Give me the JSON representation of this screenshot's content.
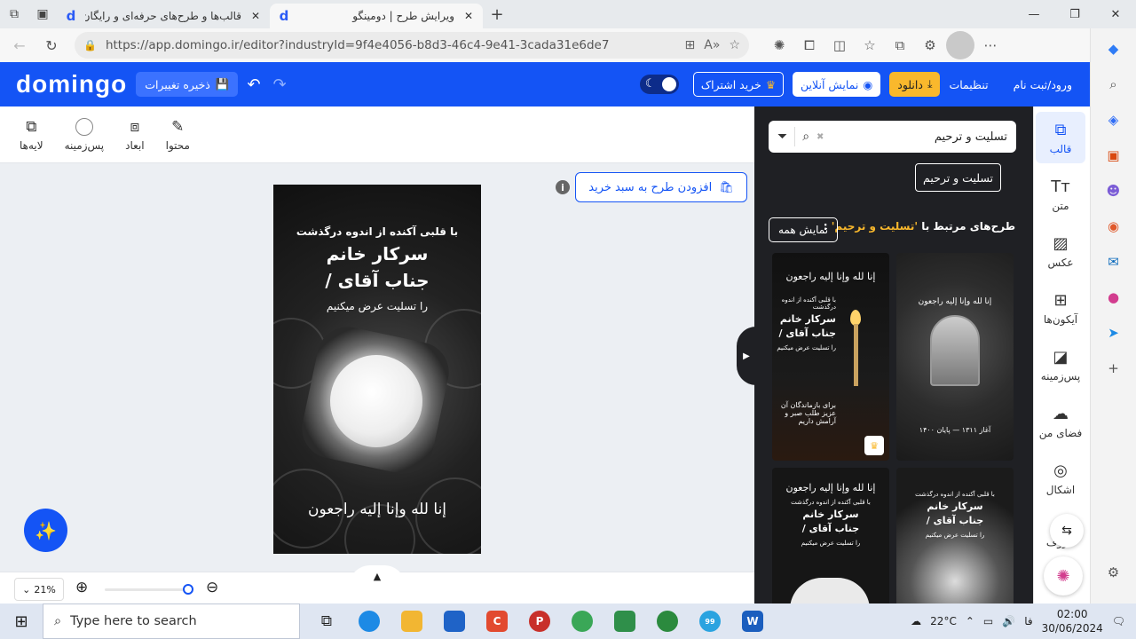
{
  "browser": {
    "tabs": [
      {
        "title": "قالب‌ها و طرح‌های حرفه‌ای و رایگان",
        "active": false
      },
      {
        "title": "ویرایش طرح | دومینگو",
        "active": true
      }
    ],
    "favicon_letter": "d",
    "new_tab": "+",
    "url": "https://app.domingo.ir/editor?industryId=9f4e4056-b8d3-46c4-9e41-3cada31e6de7"
  },
  "header": {
    "logo": "domingo",
    "save_label": "ذخیره تغییرات",
    "login_label": "ورود/ثبت نام",
    "settings_label": "تنظیمات",
    "download_label": "دانلود",
    "preview_label": "نمایش آنلاین",
    "subscribe_label": "خرید اشتراک"
  },
  "toolbar": {
    "content": "محتوا",
    "dimensions": "ابعاد",
    "background": "پس‌زمینه",
    "layers": "لایه‌ها"
  },
  "design": {
    "subtitle": "با قلبی آکنده از اندوه درگذشت",
    "line1": "سرکار خانم",
    "line2": "/ جناب آقای",
    "line3": "را تسلیت عرض میکنیم",
    "verse": "إنا لله وإنا إليه راجعون"
  },
  "editor": {
    "add_to_cart": "افزودن طرح به سبد خرید",
    "info": "i",
    "zoom": "21%"
  },
  "panel": {
    "search_value": "تسلیت و ترحیم",
    "chip": "تسلیت و ترحیم",
    "related_prefix": "طرح‌های مرتبط با",
    "related_keyword": "'تسلیت و ترحیم'",
    "related_suffix": ":",
    "show_all": "نمایش همه",
    "cards": [
      {
        "verse": "إنا لله وإنا إليه راجعون",
        "sub": "با قلبی آکنده از اندوه درگذشت",
        "l1": "سرکار خانم",
        "l2": "/ جناب آقای",
        "l3": "را تسلیت عرض میکنیم",
        "foot": "برای بازماندگان آن عزیز طلب صبر و آرامش داریم"
      },
      {
        "verse": "إنا لله وإنا إليه راجعون",
        "foot": "آغاز ۱۳۱۱ — پایان ۱۴۰۰"
      },
      {
        "verse": "إنا لله وإنا إليه راجعون",
        "sub": "با قلبی آکنده از اندوه درگذشت",
        "l1": "سرکار خانم",
        "l2": "/ جناب آقای",
        "l3": "را تسلیت عرض میکنیم"
      },
      {
        "sub": "با قلبی آکنده از اندوه درگذشت",
        "l1": "سرکار خانم",
        "l2": "/ جناب آقای",
        "l3": "را تسلیت عرض میکنیم"
      }
    ]
  },
  "rail": {
    "template": "قالب",
    "text": "متن",
    "photo": "عکس",
    "icons": "آیکون‌ها",
    "background": "پس‌زمینه",
    "my_space": "فضای من",
    "shapes": "اشکال",
    "letters": "حروف"
  },
  "taskbar": {
    "search_placeholder": "Type here to search",
    "weather": "22°C",
    "lang": "فا",
    "time": "02:00",
    "date": "30/06/2024",
    "telegram_badge": "99"
  },
  "colors": {
    "brand": "#1454f5",
    "accent": "#f9b82c",
    "panel": "#1f2024"
  }
}
